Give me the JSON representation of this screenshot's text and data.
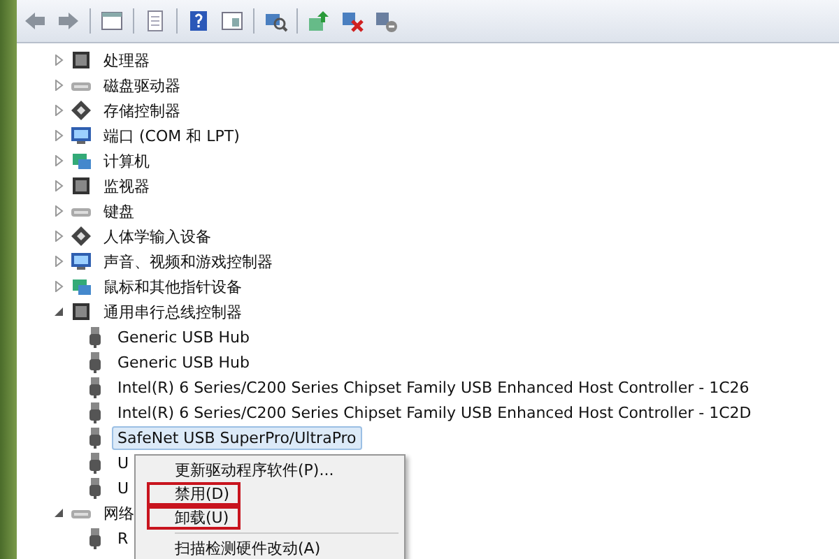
{
  "tree": [
    {
      "label": "处理器",
      "expanded": false,
      "selected": false
    },
    {
      "label": "磁盘驱动器",
      "expanded": false,
      "selected": false
    },
    {
      "label": "存储控制器",
      "expanded": false,
      "selected": false
    },
    {
      "label": "端口 (COM 和 LPT)",
      "expanded": false,
      "selected": false
    },
    {
      "label": "计算机",
      "expanded": false,
      "selected": false
    },
    {
      "label": "监视器",
      "expanded": false,
      "selected": false
    },
    {
      "label": "键盘",
      "expanded": false,
      "selected": false
    },
    {
      "label": "人体学输入设备",
      "expanded": false,
      "selected": false
    },
    {
      "label": "声音、视频和游戏控制器",
      "expanded": false,
      "selected": false
    },
    {
      "label": "鼠标和其他指针设备",
      "expanded": false,
      "selected": false
    },
    {
      "label": "通用串行总线控制器",
      "expanded": true,
      "selected": false,
      "children": [
        {
          "label": "Generic USB Hub",
          "selected": false
        },
        {
          "label": "Generic USB Hub",
          "selected": false
        },
        {
          "label": "Intel(R) 6 Series/C200 Series Chipset Family USB Enhanced Host Controller - 1C26",
          "selected": false
        },
        {
          "label": "Intel(R) 6 Series/C200 Series Chipset Family USB Enhanced Host Controller - 1C2D",
          "selected": false
        },
        {
          "label": "SafeNet USB SuperPro/UltraPro",
          "selected": true
        },
        {
          "label": "U",
          "selected": false
        },
        {
          "label": "U",
          "selected": false
        }
      ]
    },
    {
      "label": "网络",
      "expanded": true,
      "selected": false,
      "children": [
        {
          "label": "R",
          "selected": false
        }
      ]
    }
  ],
  "context_menu": [
    {
      "kind": "item",
      "label": "更新驱动程序软件(P)...",
      "highlighted": false
    },
    {
      "kind": "item",
      "label": "禁用(D)",
      "highlighted": true
    },
    {
      "kind": "item",
      "label": "卸载(U)",
      "highlighted": true
    },
    {
      "kind": "separator"
    },
    {
      "kind": "item",
      "label": "扫描检测硬件改动(A)",
      "highlighted": false
    }
  ]
}
